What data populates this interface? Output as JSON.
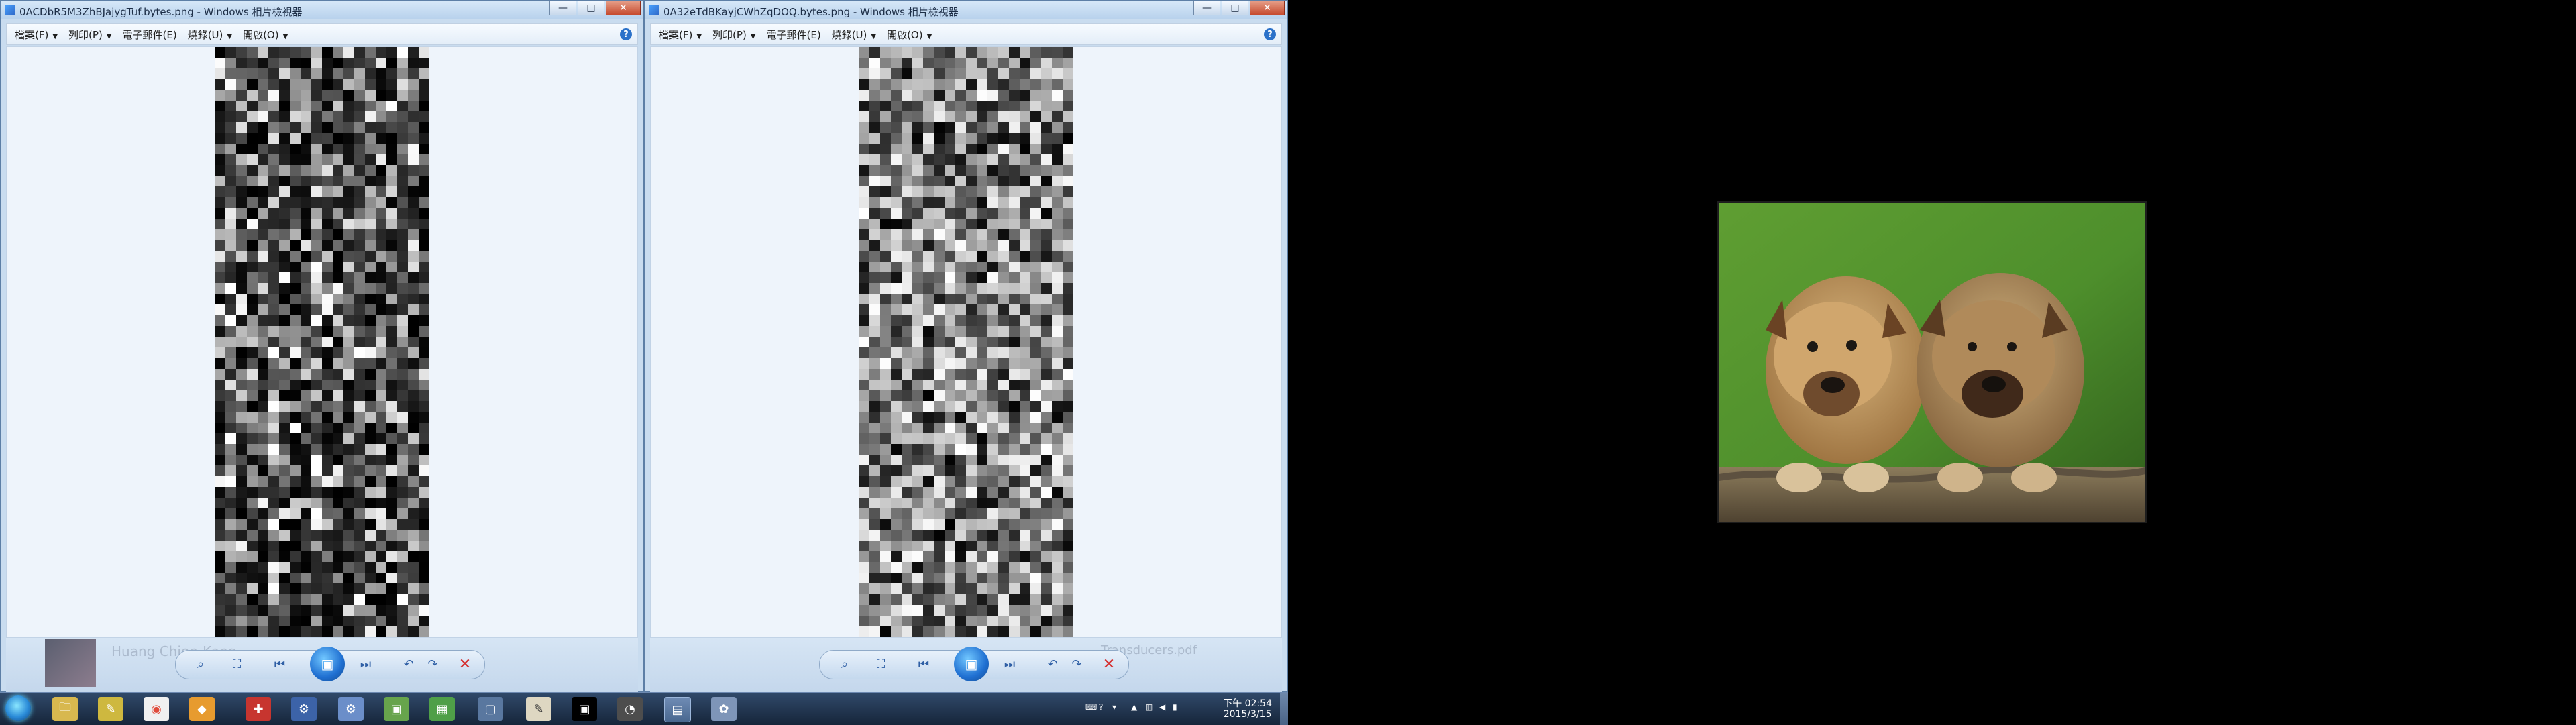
{
  "left_window": {
    "title": "0ACDbR5M3ZhBJajygTuf.bytes.png - Windows 相片檢視器",
    "menu": [
      "檔案(F)",
      "列印(P)",
      "電子郵件(E)",
      "燒錄(U)",
      "開啟(O)"
    ],
    "ghost_name": "Huang Chien-Kang"
  },
  "right_window": {
    "title": "0A32eTdBKayjCWhZqDOQ.bytes.png - Windows 相片檢視器",
    "menu": [
      "檔案(F)",
      "列印(P)",
      "電子郵件(E)",
      "燒錄(U)",
      "開啟(O)"
    ],
    "ghost_name": "Transducers.pdf"
  },
  "controls": {
    "zoom_icon": "zoom-icon",
    "fit_icon": "fit-window-icon",
    "prev_icon": "previous-icon",
    "play_icon": "slideshow-icon",
    "next_icon": "next-icon",
    "rotate_left_icon": "rotate-left-icon",
    "rotate_right_icon": "rotate-right-icon",
    "delete_icon": "delete-icon"
  },
  "taskbar": {
    "time": "下午 02:54",
    "date": "2015/3/15"
  },
  "colors": {
    "taskbar": "#1d2f47",
    "window_frame": "#c9dcef",
    "viewer_background": "#eef4fb"
  }
}
